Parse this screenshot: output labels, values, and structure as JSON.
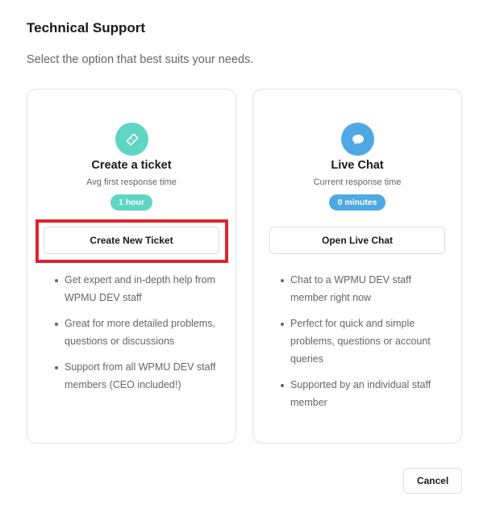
{
  "dialog": {
    "title": "Technical Support",
    "subtitle": "Select the option that best suits your needs."
  },
  "ticket_card": {
    "icon": "ticket-icon",
    "title": "Create a ticket",
    "subtitle": "Avg first response time",
    "badge": "1 hour",
    "button_label": "Create New Ticket",
    "features": [
      "Get expert and in-depth help from WPMU DEV staff",
      "Great for more detailed problems, questions or discussions",
      "Support from all WPMU DEV staff members (CEO included!)"
    ]
  },
  "chat_card": {
    "icon": "chat-bubble-icon",
    "title": "Live Chat",
    "subtitle": "Current response time",
    "badge": "0 minutes",
    "button_label": "Open Live Chat",
    "features": [
      "Chat to a WPMU DEV staff member right now",
      "Perfect for quick and simple problems, questions or account queries",
      "Supported by an individual staff member"
    ]
  },
  "footer": {
    "cancel_label": "Cancel"
  },
  "colors": {
    "ticket_accent": "#5fd6c4",
    "chat_accent": "#4fa8e4",
    "highlight": "#e0232e"
  }
}
